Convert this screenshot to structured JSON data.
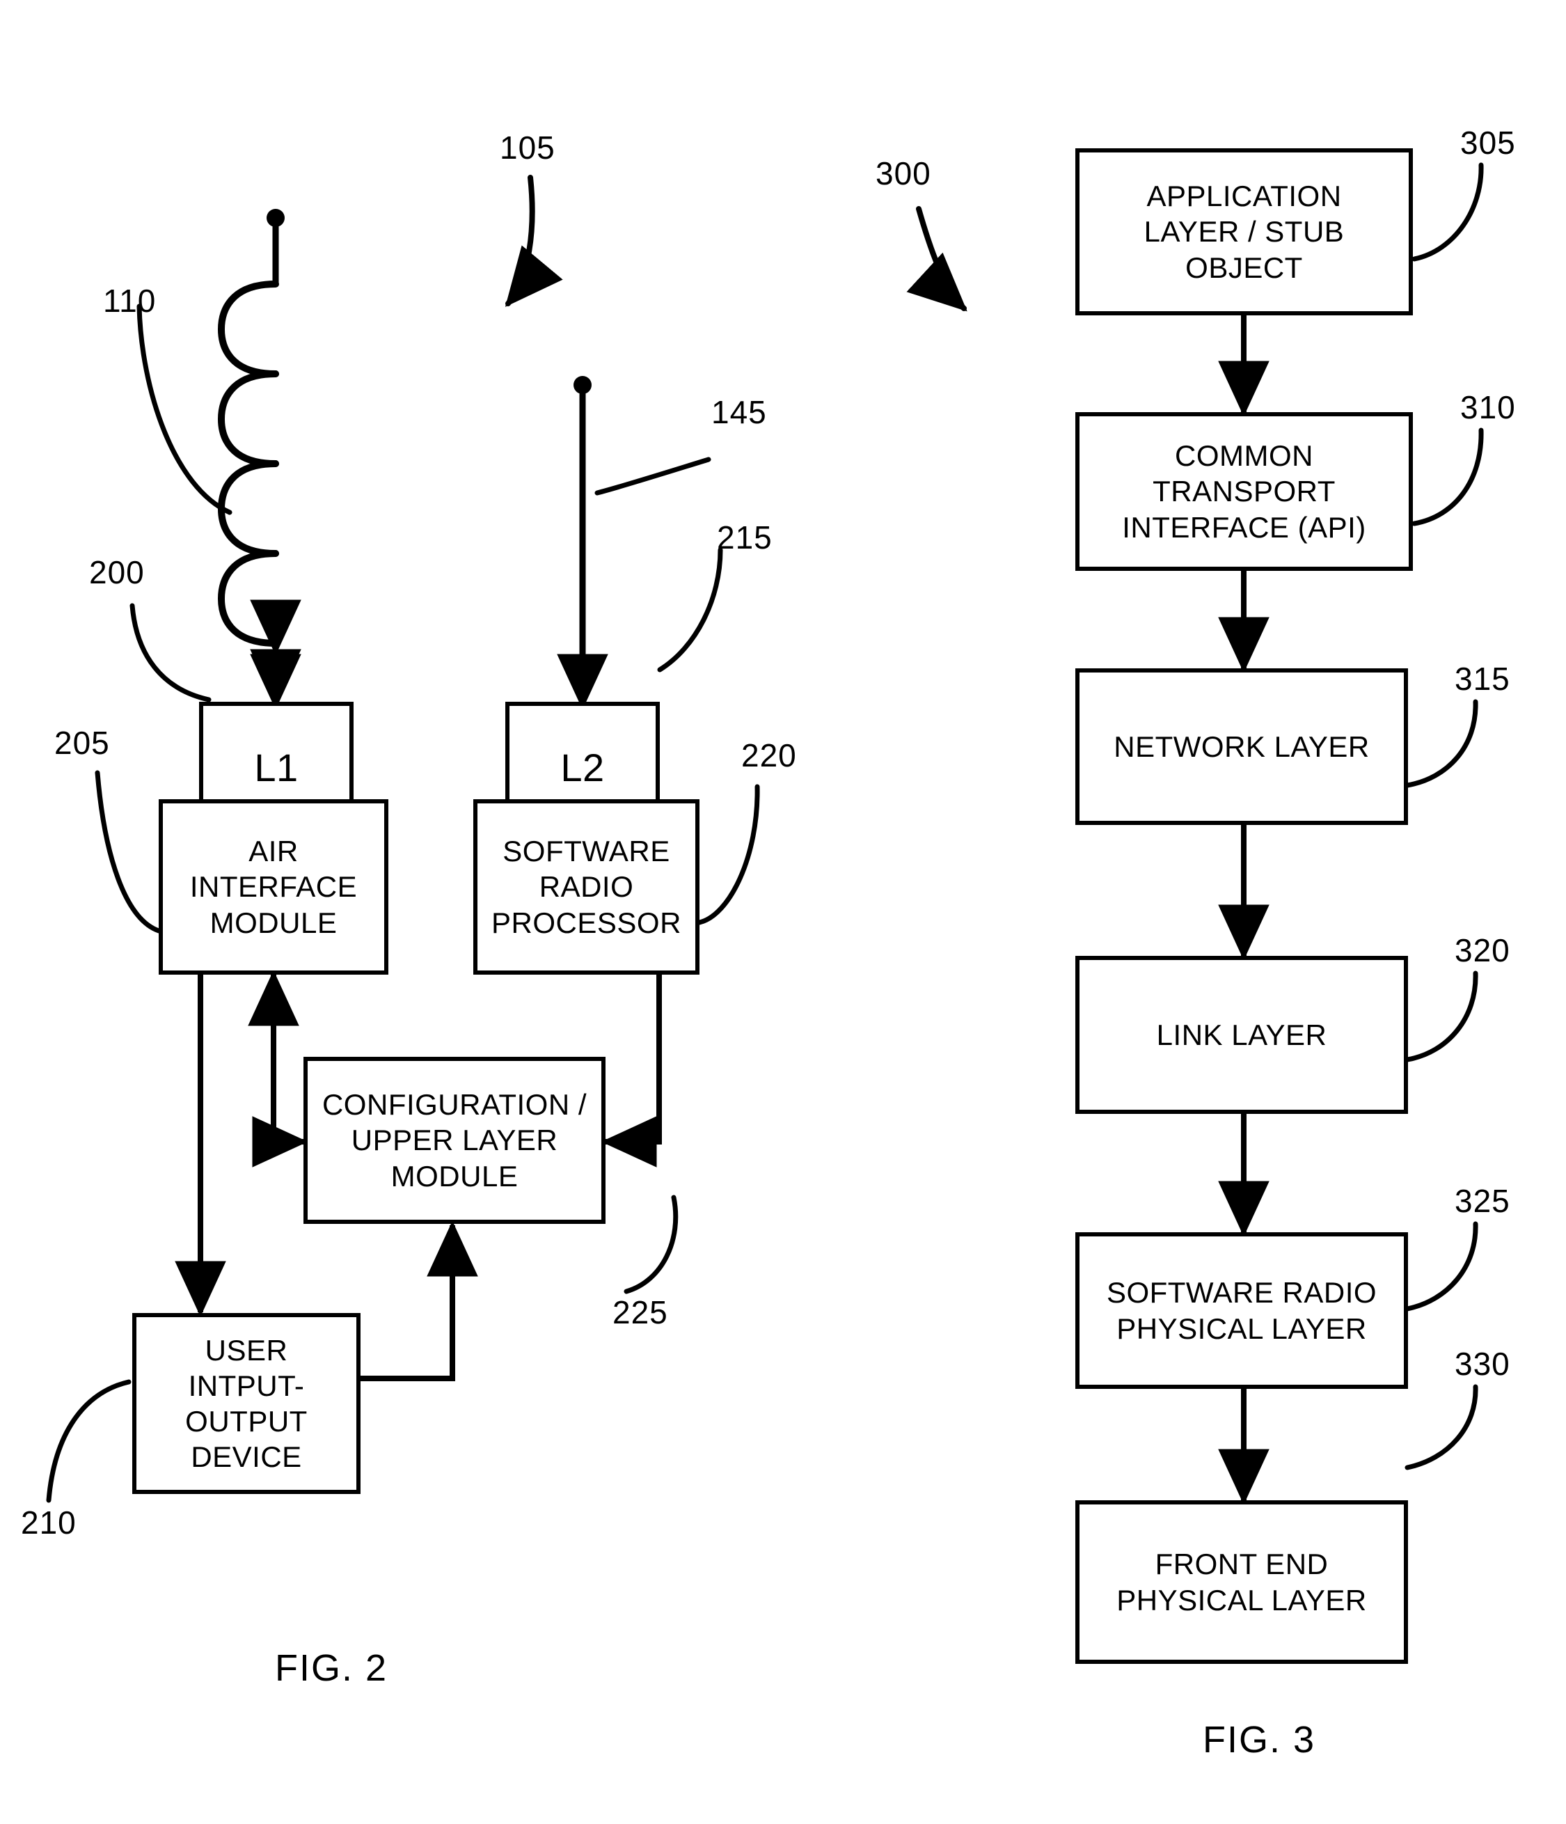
{
  "figure2": {
    "caption": "FIG. 2",
    "system_ref": "105",
    "refs": {
      "coil_antenna": "110",
      "whip_antenna": "145",
      "l1": "200",
      "l2": "215",
      "air_interface_module": "205",
      "software_radio_processor": "220",
      "configuration_upper_layer_module": "225",
      "user_io_device": "210"
    },
    "boxes": [
      {
        "id": "l1",
        "label": "L1",
        "ref": "200"
      },
      {
        "id": "l2",
        "label": "L2",
        "ref": "215"
      },
      {
        "id": "air_interface",
        "label": "AIR\nINTERFACE\nMODULE",
        "ref": "205"
      },
      {
        "id": "software_radio",
        "label": "SOFTWARE\nRADIO\nPROCESSOR",
        "ref": "220"
      },
      {
        "id": "config_upper",
        "label": "CONFIGURATION /\nUPPER LAYER\nMODULE",
        "ref": "225"
      },
      {
        "id": "user_io",
        "label": "USER\nINTPUT-\nOUTPUT\nDEVICE",
        "ref": "210"
      }
    ],
    "box_labels": {
      "l1": "L1",
      "l2": "L2",
      "air_interface_l1": "AIR",
      "air_interface_l2": "INTERFACE",
      "air_interface_l3": "MODULE",
      "software_radio_l1": "SOFTWARE",
      "software_radio_l2": "RADIO",
      "software_radio_l3": "PROCESSOR",
      "config_l1": "CONFIGURATION /",
      "config_l2": "UPPER LAYER",
      "config_l3": "MODULE",
      "user_io_l1": "USER",
      "user_io_l2": "INTPUT-",
      "user_io_l3": "OUTPUT",
      "user_io_l4": "DEVICE"
    }
  },
  "figure3": {
    "caption": "FIG. 3",
    "stack_ref": "300",
    "layers": [
      {
        "id": "application_layer",
        "ref": "305",
        "line1": "APPLICATION",
        "line2": "LAYER / STUB",
        "line3": "OBJECT"
      },
      {
        "id": "common_transport",
        "ref": "310",
        "line1": "COMMON",
        "line2": "TRANSPORT",
        "line3": "INTERFACE (API)"
      },
      {
        "id": "network_layer",
        "ref": "315",
        "line1": "NETWORK LAYER",
        "line2": "",
        "line3": ""
      },
      {
        "id": "link_layer",
        "ref": "320",
        "line1": "LINK LAYER",
        "line2": "",
        "line3": ""
      },
      {
        "id": "software_radio_phy",
        "ref": "325",
        "line1": "SOFTWARE RADIO",
        "line2": "PHYSICAL LAYER",
        "line3": ""
      },
      {
        "id": "front_end_phy",
        "ref": "330",
        "line1": "FRONT END",
        "line2": "PHYSICAL LAYER",
        "line3": ""
      }
    ]
  },
  "style": {
    "ink": "#000000",
    "paper": "#ffffff"
  }
}
